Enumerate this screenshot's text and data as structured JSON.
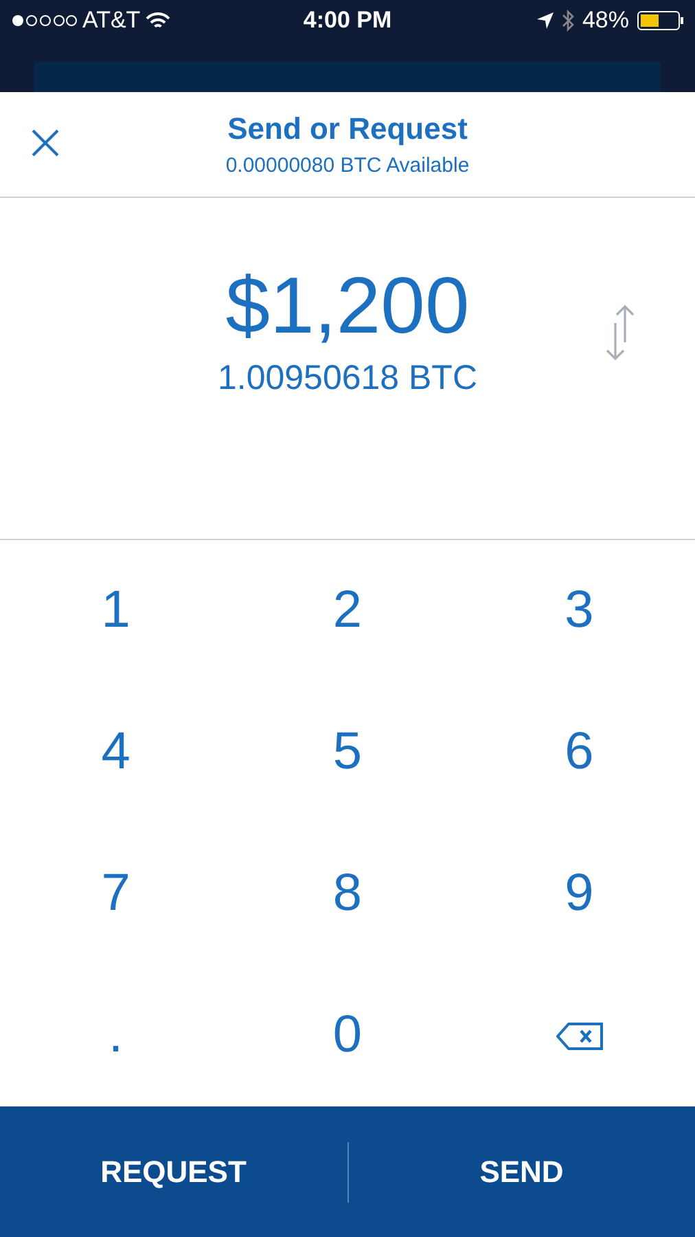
{
  "status_bar": {
    "carrier": "AT&T",
    "time": "4:00 PM",
    "battery": "48%"
  },
  "header": {
    "title": "Send or Request",
    "subtitle": "0.00000080 BTC Available"
  },
  "amount": {
    "fiat": "$1,200",
    "crypto": "1.00950618 BTC"
  },
  "keypad": [
    {
      "kind": "digit",
      "label": "1"
    },
    {
      "kind": "digit",
      "label": "2"
    },
    {
      "kind": "digit",
      "label": "3"
    },
    {
      "kind": "digit",
      "label": "4"
    },
    {
      "kind": "digit",
      "label": "5"
    },
    {
      "kind": "digit",
      "label": "6"
    },
    {
      "kind": "digit",
      "label": "7"
    },
    {
      "kind": "digit",
      "label": "8"
    },
    {
      "kind": "digit",
      "label": "9"
    },
    {
      "kind": "digit",
      "label": "."
    },
    {
      "kind": "digit",
      "label": "0"
    },
    {
      "kind": "backspace"
    }
  ],
  "actions": [
    "REQUEST",
    "SEND"
  ]
}
